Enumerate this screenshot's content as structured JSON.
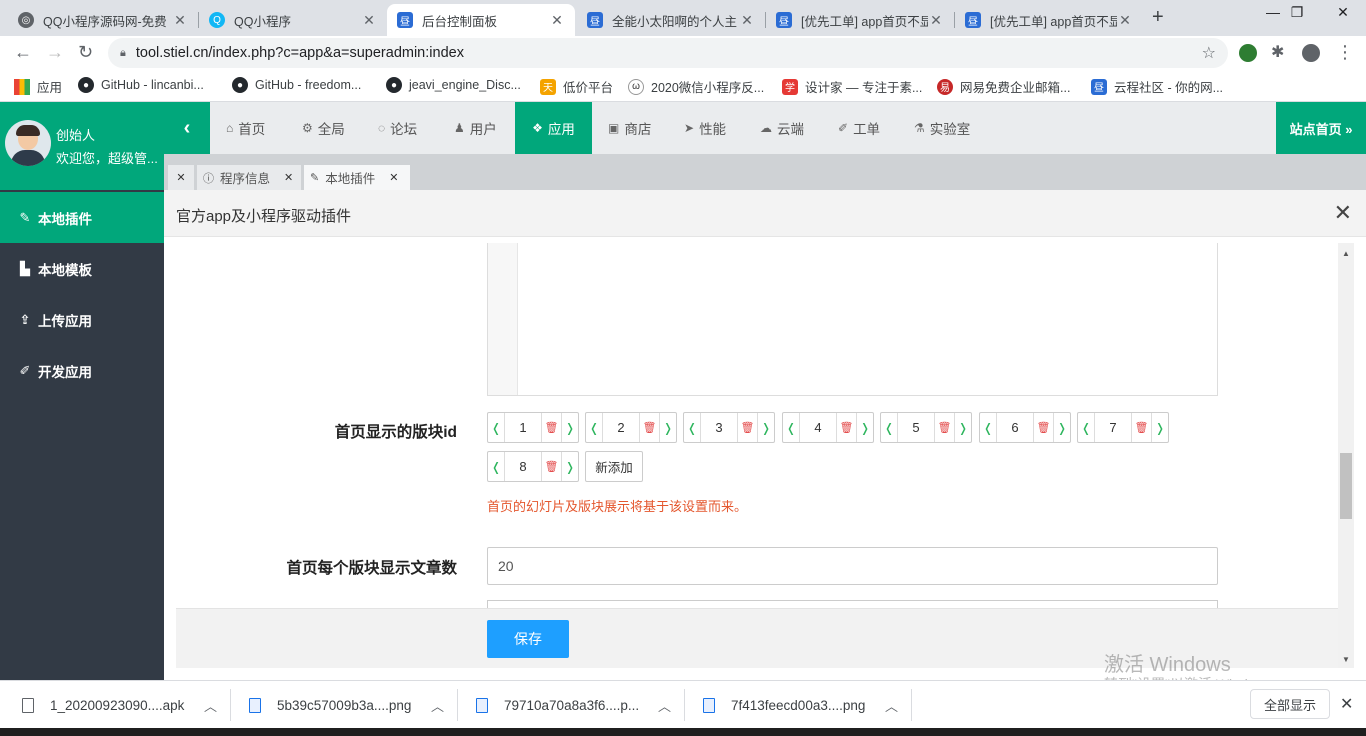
{
  "browser": {
    "tabs": [
      {
        "title": "QQ小程序源码网-免费",
        "icon": "globe-icon",
        "color": "#5f6368"
      },
      {
        "title": "QQ小程序",
        "icon": "qq-icon",
        "color": "#12b7f5"
      },
      {
        "title": "后台控制面板",
        "icon": "app-icon",
        "color": "#2b6cd4"
      },
      {
        "title": "全能小太阳啊的个人主",
        "icon": "app-icon",
        "color": "#2b6cd4"
      },
      {
        "title": "[优先工单] app首页不显",
        "icon": "app-icon",
        "color": "#2b6cd4"
      },
      {
        "title": "[优先工单] app首页不显",
        "icon": "app-icon",
        "color": "#2b6cd4"
      }
    ],
    "active_tab": 2,
    "url": "tool.stiel.cn/index.php?c=app&a=superadmin:index",
    "bookmarks": [
      {
        "label": "应用",
        "icon": "apps-grid-icon"
      },
      {
        "label": "GitHub - lincanbi...",
        "icon": "github-icon"
      },
      {
        "label": "GitHub - freedom...",
        "icon": "github-icon"
      },
      {
        "label": "jeavi_engine_Disc...",
        "icon": "github-icon"
      },
      {
        "label": "低价平台",
        "icon": "bookmark-icon"
      },
      {
        "label": "2020微信小程序反...",
        "icon": "bookmark-icon"
      },
      {
        "label": "设计家 — 专注于素...",
        "icon": "bookmark-icon"
      },
      {
        "label": "网易免费企业邮箱...",
        "icon": "bookmark-icon"
      },
      {
        "label": "云程社区 - 你的网...",
        "icon": "bookmark-icon"
      }
    ]
  },
  "user": {
    "name": "创始人",
    "welcome": "欢迎您，超级管..."
  },
  "sidebar": {
    "items": [
      {
        "label": "本地插件",
        "icon": "plugin-icon"
      },
      {
        "label": "本地模板",
        "icon": "template-icon"
      },
      {
        "label": "上传应用",
        "icon": "upload-icon"
      },
      {
        "label": "开发应用",
        "icon": "wrench-icon"
      }
    ],
    "active": 0
  },
  "topnav": {
    "items": [
      {
        "label": "首页",
        "icon": "home-icon"
      },
      {
        "label": "全局",
        "icon": "gear-icon"
      },
      {
        "label": "论坛",
        "icon": "comment-icon"
      },
      {
        "label": "用户",
        "icon": "users-icon"
      },
      {
        "label": "应用",
        "icon": "cubes-icon"
      },
      {
        "label": "商店",
        "icon": "shop-icon"
      },
      {
        "label": "性能",
        "icon": "send-icon"
      },
      {
        "label": "云端",
        "icon": "cloud-icon"
      },
      {
        "label": "工单",
        "icon": "wrench-icon"
      },
      {
        "label": "实验室",
        "icon": "flask-icon"
      }
    ],
    "active": 4,
    "site_home": "站点首页 »"
  },
  "page_tabs": [
    {
      "label": "程序信息",
      "icon": "info-icon"
    },
    {
      "label": "本地插件",
      "icon": "plugin-icon"
    }
  ],
  "panel": {
    "title": "官方app及小程序驱动插件",
    "block_ids_label": "首页显示的版块id",
    "block_ids": [
      "1",
      "2",
      "3",
      "4",
      "5",
      "6",
      "7",
      "8"
    ],
    "add_button": "新添加",
    "hint": "首页的幻灯片及版块展示将基于该设置而来。",
    "articles_label": "首页每个版块显示文章数",
    "articles_value": "20",
    "save_button": "保存"
  },
  "watermark": {
    "line1": "激活 Windows",
    "line2": "转到\"设置\"以激活 Windows。"
  },
  "downloads": {
    "items": [
      {
        "name": "1_20200923090....apk",
        "type": "apk"
      },
      {
        "name": "5b39c57009b3a....png",
        "type": "png"
      },
      {
        "name": "79710a70a8a3f6....p...",
        "type": "png"
      },
      {
        "name": "7f413feecd00a3....png",
        "type": "png"
      }
    ],
    "show_all": "全部显示"
  },
  "colors": {
    "accent": "#01a77b",
    "sidebar": "#323a45",
    "primary_button": "#1e9fff",
    "hint": "#e4572e"
  }
}
